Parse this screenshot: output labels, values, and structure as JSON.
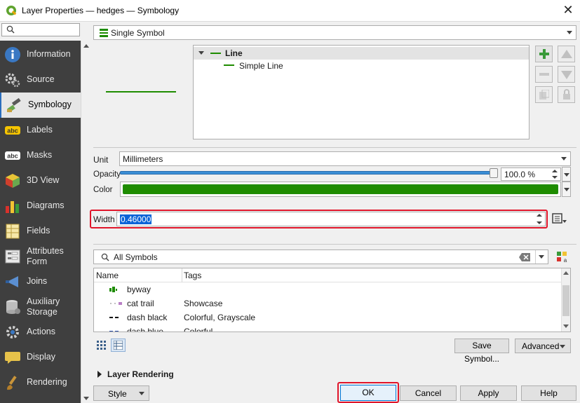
{
  "window": {
    "title": "Layer Properties — hedges — Symbology"
  },
  "sidebar": {
    "search_placeholder": "",
    "items": [
      {
        "label": "Information",
        "icon": "information-icon"
      },
      {
        "label": "Source",
        "icon": "source-icon"
      },
      {
        "label": "Symbology",
        "icon": "symbology-icon",
        "active": true
      },
      {
        "label": "Labels",
        "icon": "labels-icon"
      },
      {
        "label": "Masks",
        "icon": "masks-icon"
      },
      {
        "label": "3D View",
        "icon": "3d-view-icon"
      },
      {
        "label": "Diagrams",
        "icon": "diagrams-icon"
      },
      {
        "label": "Fields",
        "icon": "fields-icon"
      },
      {
        "label": "Attributes Form",
        "line1": "Attributes",
        "line2": "Form",
        "icon": "attributes-form-icon"
      },
      {
        "label": "Joins",
        "icon": "joins-icon"
      },
      {
        "label": "Auxiliary Storage",
        "line1": "Auxiliary",
        "line2": "Storage",
        "icon": "auxiliary-storage-icon"
      },
      {
        "label": "Actions",
        "icon": "actions-icon"
      },
      {
        "label": "Display",
        "icon": "display-icon"
      },
      {
        "label": "Rendering",
        "icon": "rendering-icon"
      }
    ]
  },
  "renderer": {
    "type_label": "Single Symbol"
  },
  "symbol_tree": {
    "root_label": "Line",
    "child_label": "Simple Line"
  },
  "properties": {
    "unit_label": "Unit",
    "unit_value": "Millimeters",
    "opacity_label": "Opacity",
    "opacity_value": "100.0 %",
    "opacity_fraction": 1.0,
    "color_label": "Color",
    "color_value": "#1e8c00",
    "width_label": "Width",
    "width_value": "0.46000"
  },
  "library": {
    "filter_value": "All Symbols",
    "columns": [
      "Name",
      "Tags"
    ],
    "rows": [
      {
        "name": "byway",
        "tags": "",
        "icon": "byway-symbol-icon"
      },
      {
        "name": "cat trail",
        "tags": "Showcase",
        "icon": "cat-trail-symbol-icon"
      },
      {
        "name": "dash  black",
        "tags": "Colorful, Grayscale",
        "icon": "dash-black-symbol-icon"
      },
      {
        "name": "dash blue",
        "tags": "Colorful",
        "icon": "dash-blue-symbol-icon"
      }
    ],
    "save_symbol_label": "Save Symbol...",
    "advanced_label": "Advanced"
  },
  "layer_rendering_label": "Layer Rendering",
  "footer": {
    "style_label": "Style",
    "ok_label": "OK",
    "cancel_label": "Cancel",
    "apply_label": "Apply",
    "help_label": "Help"
  },
  "colors": {
    "accent": "#2a6dbd",
    "highlight": "#e0152a",
    "symbol_green": "#1e8c00",
    "sidebar_bg": "#3f3f3f"
  }
}
